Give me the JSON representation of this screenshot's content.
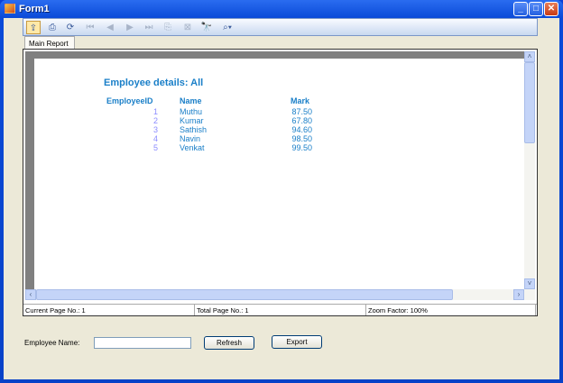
{
  "window": {
    "title": "Form1",
    "minimize": "_",
    "maximize": "□",
    "close": "✕"
  },
  "toolbar": {
    "icons": [
      "export-icon",
      "print-icon",
      "refresh-icon",
      "first-page-icon",
      "previous-page-icon",
      "next-page-icon",
      "last-page-icon",
      "goto-page-icon",
      "close-view-icon",
      "find-icon",
      "zoom-icon"
    ]
  },
  "tab": {
    "label": "Main Report"
  },
  "report": {
    "title": "Employee details:  All",
    "headers": {
      "id": "EmployeeID",
      "name": "Name",
      "mark": "Mark"
    },
    "rows": [
      {
        "id": "1",
        "name": "Muthu",
        "mark": "87.50"
      },
      {
        "id": "2",
        "name": "Kumar",
        "mark": "67.80"
      },
      {
        "id": "3",
        "name": "Sathish",
        "mark": "94.60"
      },
      {
        "id": "4",
        "name": "Navin",
        "mark": "98.50"
      },
      {
        "id": "5",
        "name": "Venkat",
        "mark": "99.50"
      }
    ]
  },
  "status": {
    "current_page": "Current Page No.: 1",
    "total_page": "Total Page No.: 1",
    "zoom": "Zoom Factor: 100%"
  },
  "form": {
    "employee_name_label": "Employee Name:",
    "employee_name_value": "",
    "refresh_label": "Refresh",
    "export_label": "Export"
  }
}
